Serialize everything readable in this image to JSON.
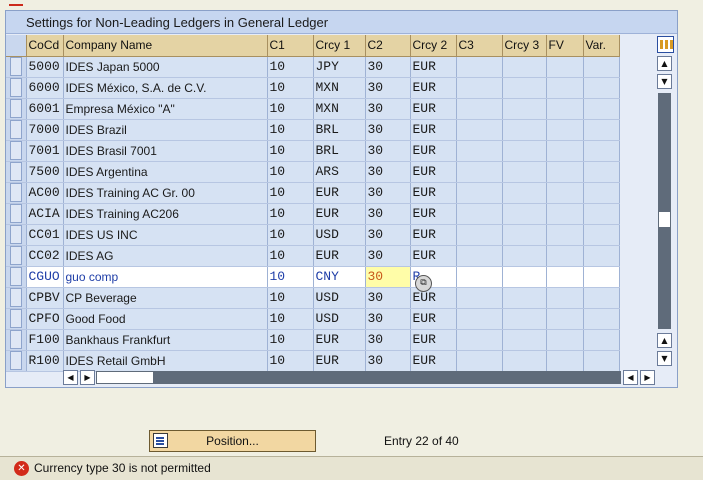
{
  "title": "Settings for Non-Leading Ledgers in General Ledger",
  "columns": [
    "CoCd",
    "Company Name",
    "C1",
    "Crcy 1",
    "C2",
    "Crcy 2",
    "C3",
    "Crcy 3",
    "FV",
    "Var."
  ],
  "rows": [
    [
      "5000",
      "IDES Japan 5000",
      "10",
      "JPY",
      "30",
      "EUR",
      "",
      "",
      "",
      ""
    ],
    [
      "6000",
      "IDES México, S.A. de C.V.",
      "10",
      "MXN",
      "30",
      "EUR",
      "",
      "",
      "",
      ""
    ],
    [
      "6001",
      "Empresa México \"A\"",
      "10",
      "MXN",
      "30",
      "EUR",
      "",
      "",
      "",
      ""
    ],
    [
      "7000",
      "IDES Brazil",
      "10",
      "BRL",
      "30",
      "EUR",
      "",
      "",
      "",
      ""
    ],
    [
      "7001",
      "IDES Brasil 7001",
      "10",
      "BRL",
      "30",
      "EUR",
      "",
      "",
      "",
      ""
    ],
    [
      "7500",
      "IDES Argentina",
      "10",
      "ARS",
      "30",
      "EUR",
      "",
      "",
      "",
      ""
    ],
    [
      "AC00",
      "IDES Training AC Gr. 00",
      "10",
      "EUR",
      "30",
      "EUR",
      "",
      "",
      "",
      ""
    ],
    [
      "ACIA",
      "IDES Training AC206",
      "10",
      "EUR",
      "30",
      "EUR",
      "",
      "",
      "",
      ""
    ],
    [
      "CC01",
      "IDES US INC",
      "10",
      "USD",
      "30",
      "EUR",
      "",
      "",
      "",
      ""
    ],
    [
      "CC02",
      "IDES AG",
      "10",
      "EUR",
      "30",
      "EUR",
      "",
      "",
      "",
      ""
    ],
    [
      "CGUO",
      "guo comp",
      "10",
      "CNY",
      "30",
      "R",
      "",
      "",
      "",
      ""
    ],
    [
      "CPBV",
      "CP Beverage",
      "10",
      "USD",
      "30",
      "EUR",
      "",
      "",
      "",
      ""
    ],
    [
      "CPFO",
      "Good Food",
      "10",
      "USD",
      "30",
      "EUR",
      "",
      "",
      "",
      ""
    ],
    [
      "F100",
      "Bankhaus Frankfurt",
      "10",
      "EUR",
      "30",
      "EUR",
      "",
      "",
      "",
      ""
    ],
    [
      "R100",
      "IDES Retail GmbH",
      "10",
      "EUR",
      "30",
      "EUR",
      "",
      "",
      "",
      ""
    ]
  ],
  "editing_row_index": 10,
  "active_cell_column": 4,
  "position_button": "Position...",
  "entry_info": "Entry 22 of 40",
  "status_message": "Currency type 30 is not permitted",
  "icons": {
    "position": "position-list-icon",
    "configure": "table-settings-icon",
    "error": "error-icon",
    "scroll_up": "scroll-up-icon",
    "scroll_down": "scroll-down-icon",
    "scroll_left": "scroll-left-icon",
    "scroll_right": "scroll-right-icon"
  },
  "colors": {
    "header": "#e4d3a4",
    "row": "#d6e2f3",
    "edit_text": "#1f3ea8",
    "active_cell": "#fffda8",
    "error": "#d22a1a"
  }
}
